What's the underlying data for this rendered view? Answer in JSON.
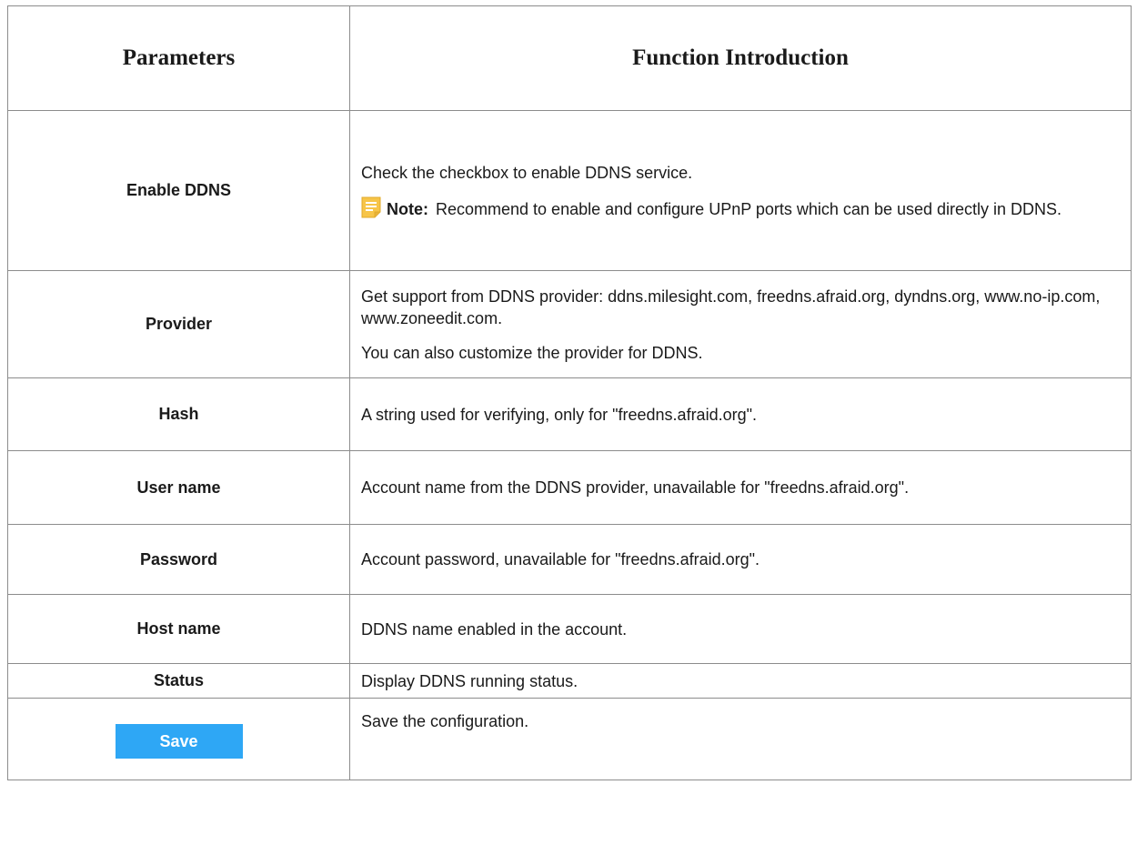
{
  "header": {
    "col1": "Parameters",
    "col2": "Function Introduction"
  },
  "rows": {
    "enable": {
      "name": "Enable DDNS",
      "desc1": "Check the checkbox to enable DDNS service.",
      "note_label": "Note:",
      "note_text": "Recommend to enable and configure UPnP ports which can be used directly in DDNS.",
      "note_icon": "note-icon"
    },
    "provider": {
      "name": "Provider",
      "desc1": "Get support from DDNS provider: ddns.milesight.com, freedns.afraid.org, dyndns.org, www.no-ip.com, www.zoneedit.com.",
      "desc2": "You can also customize the provider for DDNS."
    },
    "hash": {
      "name": "Hash",
      "desc": "A string used for verifying, only for \"freedns.afraid.org\"."
    },
    "user": {
      "name": "User name",
      "desc": "Account name from the DDNS provider, unavailable for \"freedns.afraid.org\"."
    },
    "password": {
      "name": "Password",
      "desc": "Account password, unavailable for \"freedns.afraid.org\"."
    },
    "host": {
      "name": "Host name",
      "desc": "DDNS name enabled in the account."
    },
    "status": {
      "name": "Status",
      "desc": "Display DDNS running status."
    },
    "save": {
      "button_label": "Save",
      "desc": "Save the configuration."
    }
  },
  "colors": {
    "save_button": "#2ea7f5",
    "note_icon": "#f7c548",
    "border": "#8c8c8c"
  }
}
